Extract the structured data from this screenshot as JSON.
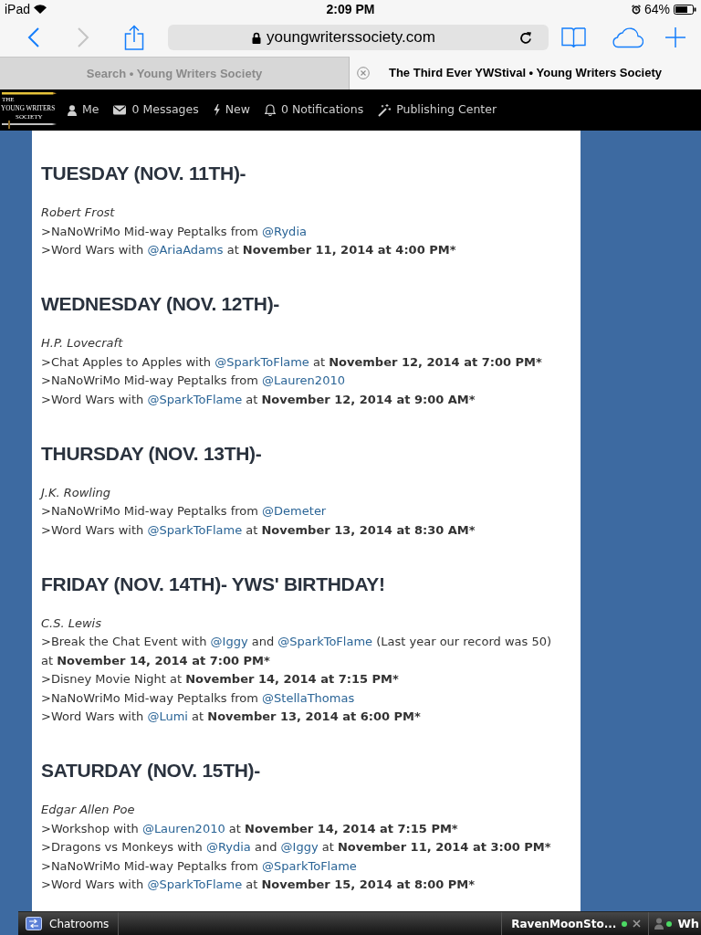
{
  "status_bar": {
    "device": "iPad",
    "time": "2:09 PM",
    "battery": "64%"
  },
  "toolbar": {
    "nav_buttons": [
      {
        "kind": "back",
        "disabled": false
      },
      {
        "kind": "forward",
        "disabled": true
      }
    ],
    "url": "youngwriterssociety.com"
  },
  "tabs": [
    {
      "title": "Search • Young Writers Society",
      "selected": false
    },
    {
      "title": "The Third Ever YWStival • Young Writers Society",
      "selected": true
    }
  ],
  "site_nav": {
    "logo_lines": [
      "THE",
      "YOUNG WRITERS",
      "SOCIETY"
    ],
    "items": [
      {
        "kind": "user",
        "label": "Me"
      },
      {
        "kind": "messages",
        "label": "0 Messages"
      },
      {
        "kind": "new",
        "label": "New"
      },
      {
        "kind": "notifications",
        "label": "0 Notifications"
      },
      {
        "kind": "publishing",
        "label": "Publishing Center"
      }
    ]
  },
  "days": [
    {
      "heading": "TUESDAY (NOV. 11TH)-",
      "author": "Robert Frost",
      "lines": [
        [
          {
            "kind": "text",
            "text": ">NaNoWriMo Mid-way Peptalks from "
          },
          {
            "kind": "link",
            "text": "@Rydia"
          }
        ],
        [
          {
            "kind": "text",
            "text": ">Word Wars with "
          },
          {
            "kind": "link",
            "text": "@AriaAdams"
          },
          {
            "kind": "text",
            "text": " at "
          },
          {
            "kind": "bold",
            "text": "November 11, 2014 at 4:00 PM*"
          }
        ]
      ]
    },
    {
      "heading": "WEDNESDAY (NOV. 12TH)-",
      "author": "H.P. Lovecraft",
      "lines": [
        [
          {
            "kind": "text",
            "text": ">Chat Apples to Apples with "
          },
          {
            "kind": "link",
            "text": "@SparkToFlame"
          },
          {
            "kind": "text",
            "text": " at "
          },
          {
            "kind": "bold",
            "text": "November 12, 2014 at 7:00 PM*"
          }
        ],
        [
          {
            "kind": "text",
            "text": ">NaNoWriMo Mid-way Peptalks from "
          },
          {
            "kind": "link",
            "text": "@Lauren2010"
          }
        ],
        [
          {
            "kind": "text",
            "text": ">Word Wars with "
          },
          {
            "kind": "link",
            "text": "@SparkToFlame"
          },
          {
            "kind": "text",
            "text": " at "
          },
          {
            "kind": "bold",
            "text": "November 12, 2014 at 9:00 AM*"
          }
        ]
      ]
    },
    {
      "heading": "THURSDAY (NOV. 13TH)-",
      "author": "J.K. Rowling",
      "lines": [
        [
          {
            "kind": "text",
            "text": ">NaNoWriMo Mid-way Peptalks from "
          },
          {
            "kind": "link",
            "text": "@Demeter"
          }
        ],
        [
          {
            "kind": "text",
            "text": ">Word Wars with "
          },
          {
            "kind": "link",
            "text": "@SparkToFlame"
          },
          {
            "kind": "text",
            "text": " at "
          },
          {
            "kind": "bold",
            "text": "November 13, 2014 at 8:30 AM*"
          }
        ]
      ]
    },
    {
      "heading": "FRIDAY (NOV. 14TH)- YWS' BIRTHDAY!",
      "author": "C.S. Lewis",
      "lines": [
        [
          {
            "kind": "text",
            "text": ">Break the Chat Event with "
          },
          {
            "kind": "link",
            "text": "@Iggy"
          },
          {
            "kind": "text",
            "text": " and "
          },
          {
            "kind": "link",
            "text": "@SparkToFlame"
          },
          {
            "kind": "text",
            "text": " (Last year our record was 50) at "
          },
          {
            "kind": "bold",
            "text": "November 14, 2014 at 7:00 PM*"
          }
        ],
        [
          {
            "kind": "text",
            "text": ">Disney Movie Night at "
          },
          {
            "kind": "bold",
            "text": "November 14, 2014 at 7:15 PM*"
          }
        ],
        [
          {
            "kind": "text",
            "text": ">NaNoWriMo Mid-way Peptalks from "
          },
          {
            "kind": "link",
            "text": "@StellaThomas"
          }
        ],
        [
          {
            "kind": "text",
            "text": ">Word Wars with "
          },
          {
            "kind": "link",
            "text": "@Lumi"
          },
          {
            "kind": "text",
            "text": " at "
          },
          {
            "kind": "bold",
            "text": "November 13, 2014 at 6:00 PM*"
          }
        ]
      ]
    },
    {
      "heading": "SATURDAY (NOV. 15TH)-",
      "author": "Edgar Allen Poe",
      "lines": [
        [
          {
            "kind": "text",
            "text": ">Workshop with "
          },
          {
            "kind": "link",
            "text": "@Lauren2010"
          },
          {
            "kind": "text",
            "text": " at "
          },
          {
            "kind": "bold",
            "text": "November 14, 2014 at 7:15 PM*"
          }
        ],
        [
          {
            "kind": "text",
            "text": ">Dragons vs Monkeys with "
          },
          {
            "kind": "link",
            "text": "@Rydia"
          },
          {
            "kind": "text",
            "text": " and "
          },
          {
            "kind": "link",
            "text": "@Iggy"
          },
          {
            "kind": "text",
            "text": " at "
          },
          {
            "kind": "bold",
            "text": "November 11, 2014 at 3:00 PM*"
          }
        ],
        [
          {
            "kind": "text",
            "text": ">NaNoWriMo Mid-way Peptalks from "
          },
          {
            "kind": "link",
            "text": "@SparkToFlame"
          }
        ],
        [
          {
            "kind": "text",
            "text": ">Word Wars with "
          },
          {
            "kind": "link",
            "text": "@SparkToFlame"
          },
          {
            "kind": "text",
            "text": " at "
          },
          {
            "kind": "bold",
            "text": "November 15, 2014 at 8:00 PM*"
          }
        ]
      ]
    }
  ],
  "chat_bar": {
    "rooms_label": "Chatrooms",
    "chats": [
      {
        "kind": "chat",
        "name": "RavenMoonSto...",
        "online": true
      },
      {
        "kind": "online_list",
        "name": "Wh",
        "online": true
      }
    ]
  }
}
